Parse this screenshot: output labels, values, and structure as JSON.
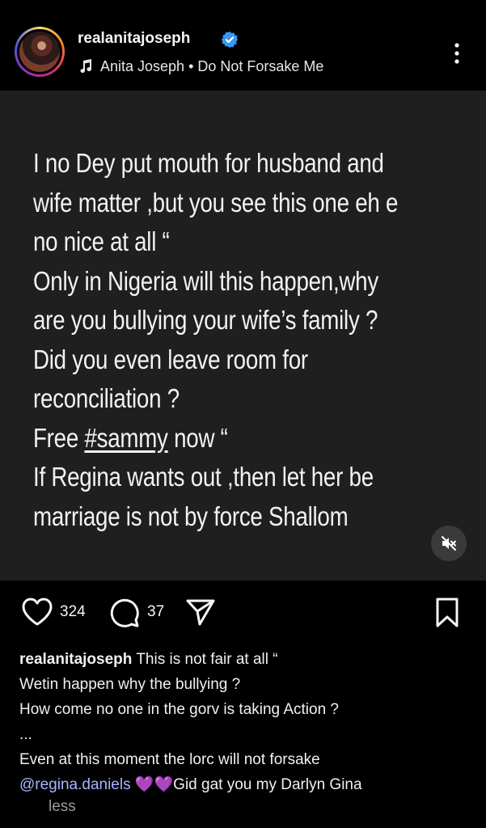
{
  "header": {
    "username": "realanitajoseph",
    "audio_label": "Anita Joseph • Do Not Forsake Me"
  },
  "post": {
    "lines": [
      "I no Dey put mouth for husband and",
      "wife matter ,but you see this one eh e",
      "no nice at all “",
      "Only in Nigeria will this happen,why",
      "are you bullying your wife’s family ?",
      "Did you even leave room for",
      "reconciliation ?"
    ],
    "free_prefix": "Free ",
    "hashtag": "#sammy",
    "free_suffix": " now “",
    "lines_after": [
      "If Regina wants out ,then let her be",
      "marriage is not by force Shallom"
    ]
  },
  "actions": {
    "likes": "324",
    "comments": "37"
  },
  "caption": {
    "username": "realanitajoseph",
    "first_line": " This is not fair at all “",
    "lines": [
      "Wetin happen why the bullying ?",
      "How come no one in the gorv is taking Action ?",
      "...",
      "Even at this moment the lorc will not forsake"
    ],
    "mention": "@regina.daniels",
    "last_tail": " 💜💜Gid gat you my Darlyn Gina",
    "less_label": "less"
  },
  "colors": {
    "background": "#000000",
    "post_background": "#1f1f1f",
    "mention": "#a8b5ff",
    "verified": "#3897f0"
  }
}
